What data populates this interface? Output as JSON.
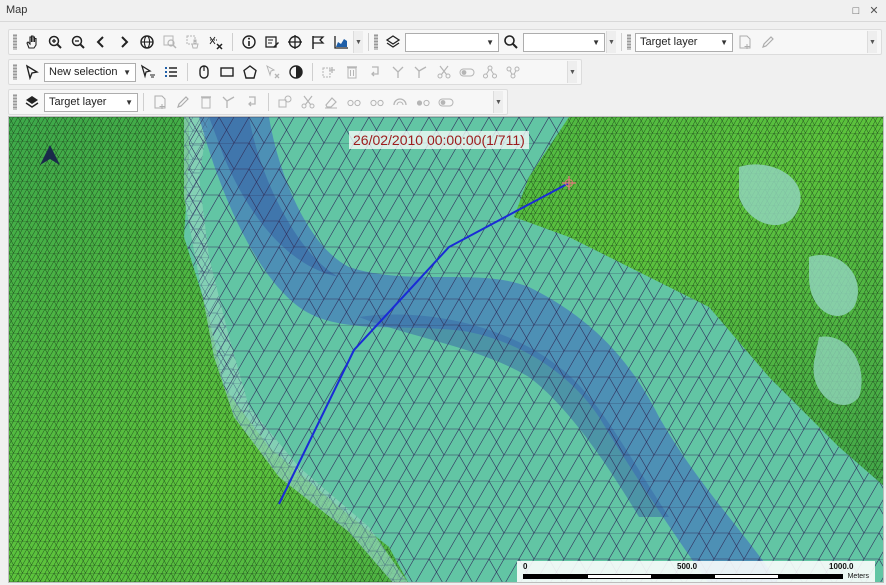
{
  "window": {
    "title": "Map",
    "restore_glyph": "□",
    "close_glyph": "✕"
  },
  "toolbar1": {
    "combo_empty_1": "",
    "combo_empty_2": "",
    "target_layer": "Target layer"
  },
  "toolbar2": {
    "selection_mode": "New selection"
  },
  "toolbar3": {
    "target_layer": "Target layer"
  },
  "map": {
    "timestamp": "26/02/2010 00:00:00(1/711)",
    "scale": {
      "labels": [
        "0",
        "500.0",
        "1000.0"
      ],
      "unit": "Meters"
    },
    "colors": {
      "shallow": "#58c8a6",
      "deep": "#3f6fae",
      "land": "#3fa34d",
      "mesh": "#2a2a5a",
      "transect": "#1a2bd6"
    }
  }
}
